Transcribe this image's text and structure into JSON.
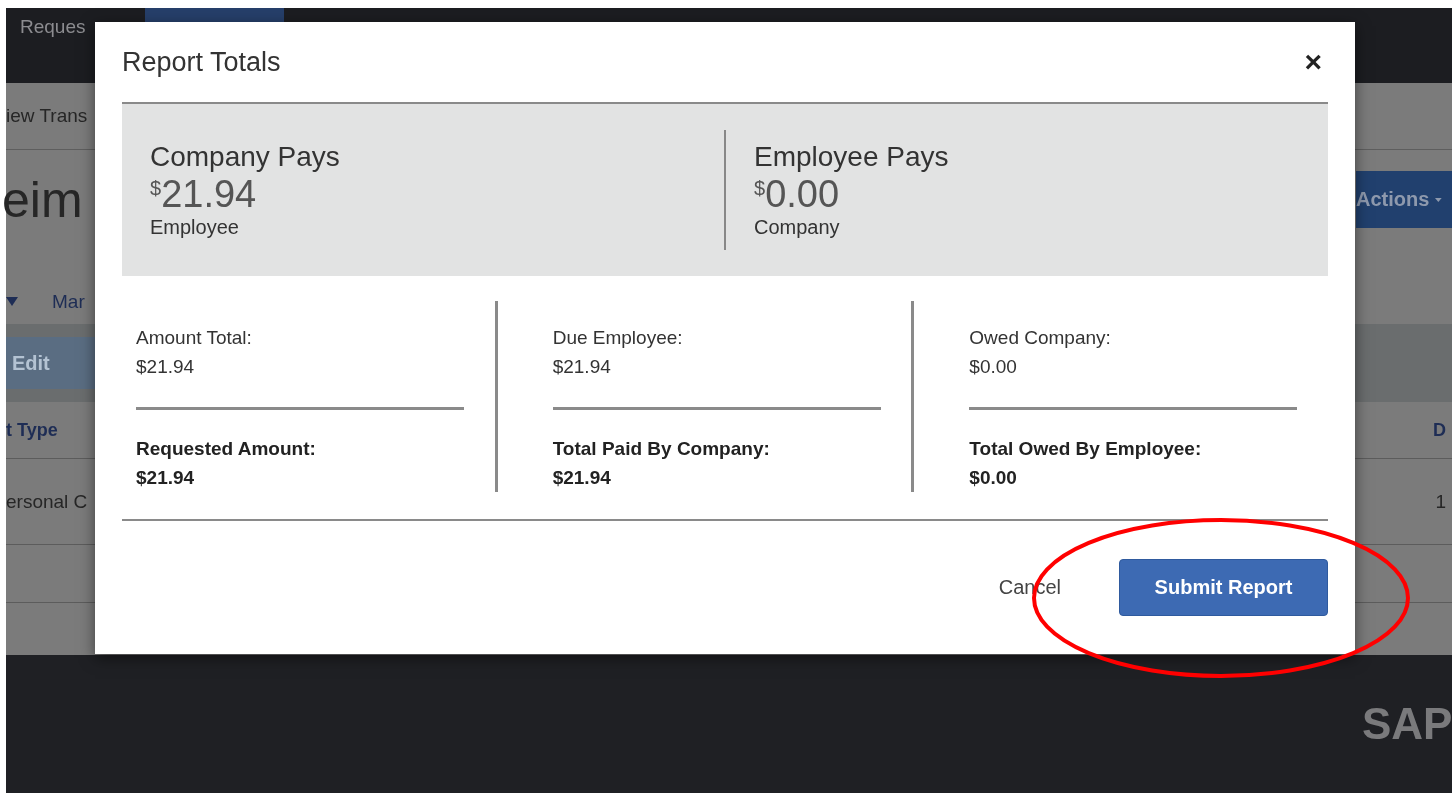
{
  "background": {
    "nav_items": [
      {
        "label": "Reques",
        "selected": false
      },
      {
        "selected": true
      }
    ],
    "subnav": "iew Trans",
    "title": "eim",
    "actions_button": "Actions",
    "tab": "Mar",
    "edit_button": "Edit",
    "table": {
      "columns": [
        "t Type",
        "D"
      ],
      "rows": [
        [
          "ersonal C",
          "1"
        ]
      ]
    },
    "footer_logo": "SAP"
  },
  "dialog": {
    "title": "Report Totals",
    "close": "×",
    "summary": [
      {
        "heading": "Company Pays",
        "currency": "$",
        "amount": "21.94",
        "party": "Employee"
      },
      {
        "heading": "Employee Pays",
        "currency": "$",
        "amount": "0.00",
        "party": "Company"
      }
    ],
    "columns": [
      {
        "label": "Amount Total:",
        "value": "$21.94",
        "total_label": "Requested Amount:",
        "total_value": "$21.94"
      },
      {
        "label": "Due Employee:",
        "value": "$21.94",
        "total_label": "Total Paid By Company:",
        "total_value": "$21.94"
      },
      {
        "label": "Owed Company:",
        "value": "$0.00",
        "total_label": "Total Owed By Employee:",
        "total_value": "$0.00"
      }
    ],
    "buttons": [
      {
        "label": "Cancel",
        "kind": "link"
      },
      {
        "label": "Submit Report",
        "kind": "primary"
      }
    ]
  }
}
